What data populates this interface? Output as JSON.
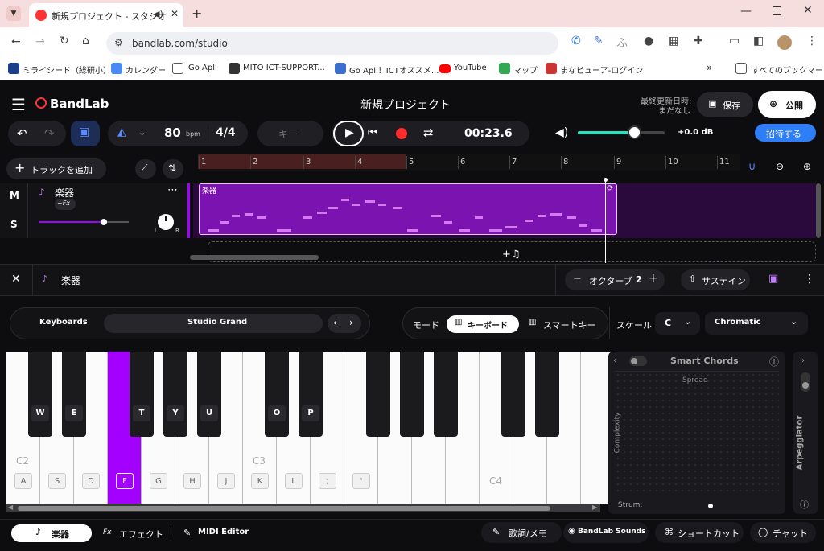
{
  "browser": {
    "tab_title": "新規プロジェクト - スタジオ",
    "url": "bandlab.com/studio",
    "bookmarks": [
      "ミライシード（総研小）",
      "カレンダー",
      "Go Apli",
      "MITO ICT-SUPPORT...",
      "Go Apli！ICTオススメ...",
      "YouTube",
      "マップ",
      "まなビューア-ログイン"
    ],
    "all_bookmarks": "すべてのブックマーク"
  },
  "header": {
    "logo": "BandLab",
    "project_title": "新規プロジェクト",
    "last_updated_label": "最終更新日時:",
    "last_updated_value": "まだなし",
    "save": "保存",
    "publish": "公開"
  },
  "transport": {
    "bpm": "80",
    "bpm_unit": "bpm",
    "time_signature": "4/4",
    "key": "キー",
    "time": "00:23.6",
    "volume_db": "+0.0 dB",
    "volume_level": 0.6,
    "invite": "招待する"
  },
  "tracks": {
    "add_track": "トラックを追加",
    "mute": "M",
    "solo": "S",
    "track_name": "楽器",
    "fx": "+Fx",
    "pan_left": "L",
    "pan_right": "R",
    "clip_label": "楽器",
    "ruler": [
      "1",
      "2",
      "3",
      "4",
      "5",
      "6",
      "7",
      "8",
      "9",
      "10",
      "11"
    ]
  },
  "instrument_panel": {
    "title": "楽器",
    "octave_label": "オクターブ",
    "octave_value": "2",
    "sustain": "サステイン",
    "category": "Keyboards",
    "preset": "Studio Grand",
    "mode_label": "モード",
    "mode_keyboard": "キーボード",
    "mode_smartkey": "スマートキー",
    "scale_label": "スケール",
    "scale_root": "C",
    "scale_type": "Chromatic"
  },
  "piano": {
    "white_labels": [
      "A",
      "S",
      "D",
      "F",
      "G",
      "H",
      "J",
      "K",
      "L",
      ";",
      "'"
    ],
    "black_labels": [
      "W",
      "E",
      "T",
      "Y",
      "U",
      "O",
      "P"
    ],
    "octave_labels": [
      "C2",
      "C3",
      "C4"
    ],
    "active_key": "F"
  },
  "smart_chords": {
    "title": "Smart Chords",
    "spread": "Spread",
    "complexity": "Complexity",
    "strum": "Strum:",
    "arpeggiator": "Arpeggiator"
  },
  "bottom_bar": {
    "instrument": "楽器",
    "effects": "エフェクト",
    "midi_editor": "MIDI Editor",
    "lyrics": "歌詞/メモ",
    "bandlab_sounds": "BandLab Sounds",
    "shortcuts": "ショートカット",
    "chat": "チャット"
  },
  "colors": {
    "accent": "#a300ff",
    "blue": "#2d7ef7",
    "record": "#ff2d2d",
    "clip": "#7a13b0"
  }
}
